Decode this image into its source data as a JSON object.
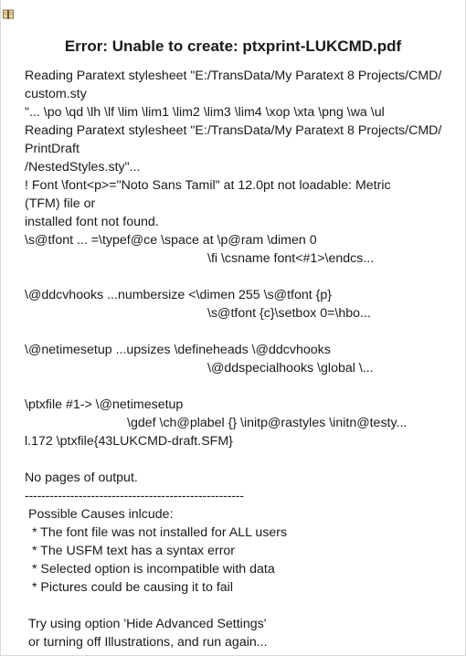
{
  "dialog": {
    "icon": "book-icon",
    "heading": "Error: Unable to create: ptxprint-LUKCMD.pdf"
  },
  "log": {
    "lines": [
      "Reading Paratext stylesheet \"E:/TransData/My Paratext 8 Projects/CMD/",
      "custom.sty",
      "\"... \\po \\qd \\lh \\lf \\lim \\lim1 \\lim2 \\lim3 \\lim4 \\xop \\xta \\png \\wa \\ul",
      "Reading Paratext stylesheet \"E:/TransData/My Paratext 8 Projects/CMD/",
      "PrintDraft",
      "/NestedStyles.sty\"...",
      "! Font \\font<p>=\"Noto Sans Tamil\" at 12.0pt not loadable: Metric",
      "(TFM) file or",
      "installed font not found.",
      "\\s@tfont ... =\\typef@ce \\space at \\p@ram \\dimen 0",
      "\\fi \\csname font<#1>\\endcs...",
      "",
      "\\@ddcvhooks ...numbersize <\\dimen 255 \\s@tfont {p}",
      "\\s@tfont {c}\\setbox 0=\\hbo...",
      "",
      "\\@netimesetup ...upsizes \\defineheads \\@ddcvhooks",
      "\\@ddspecialhooks \\global \\...",
      "",
      "\\ptxfile #1-> \\@netimesetup",
      "\\gdef \\ch@plabel {} \\initp@rastyles \\initn@testy...",
      "l.172 \\ptxfile{43LUKCMD-draft.SFM}",
      "",
      "No pages of output.",
      "-----------------------------------------------------",
      "Possible Causes inlcude:",
      " * The font file was not installed for ALL users",
      " * The USFM text has a syntax error",
      " * Selected option is incompatible with data",
      " * Pictures could be causing it to fail",
      "",
      "Try using option 'Hide Advanced Settings'",
      "or turning off Illustrations, and run again..."
    ]
  }
}
